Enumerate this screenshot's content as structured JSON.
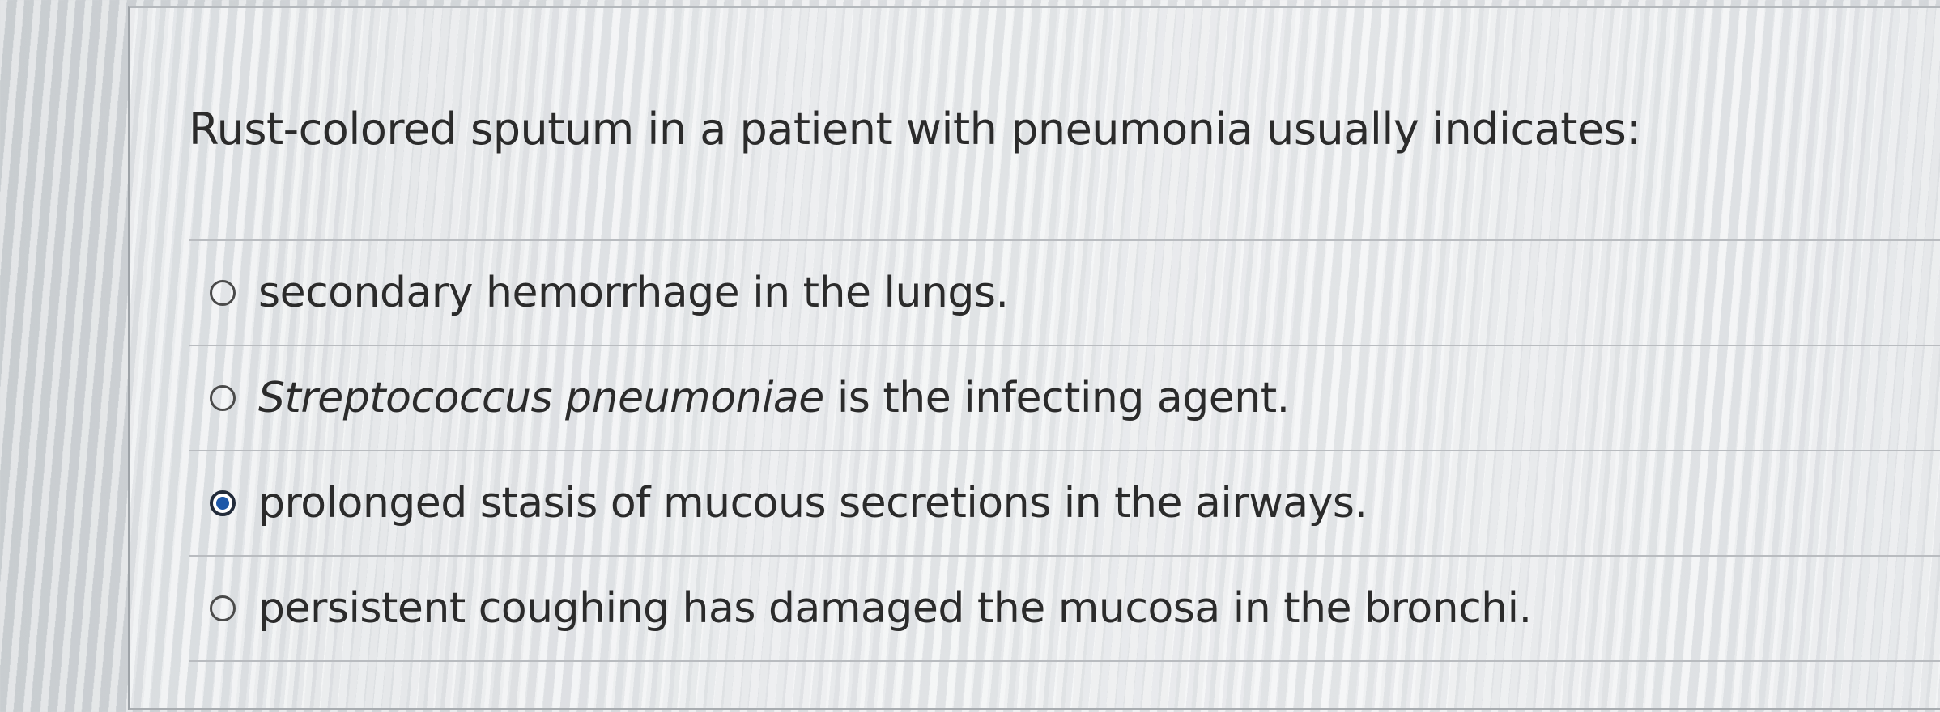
{
  "question": {
    "text": "Rust-colored sputum in a patient with pneumonia usually indicates:"
  },
  "answers": [
    {
      "id": "a",
      "selected": false,
      "text": "secondary hemorrhage in the lungs."
    },
    {
      "id": "b",
      "selected": false,
      "italic_part": "Streptococcus pneumoniae",
      "text": " is the infecting agent."
    },
    {
      "id": "c",
      "selected": true,
      "text": "prolonged stasis of mucous secretions in the airways."
    },
    {
      "id": "d",
      "selected": false,
      "text": "persistent coughing has damaged the mucosa in the bronchi."
    }
  ],
  "colors": {
    "selected_radio": "#1d57a8",
    "text": "#2b2b2b"
  }
}
